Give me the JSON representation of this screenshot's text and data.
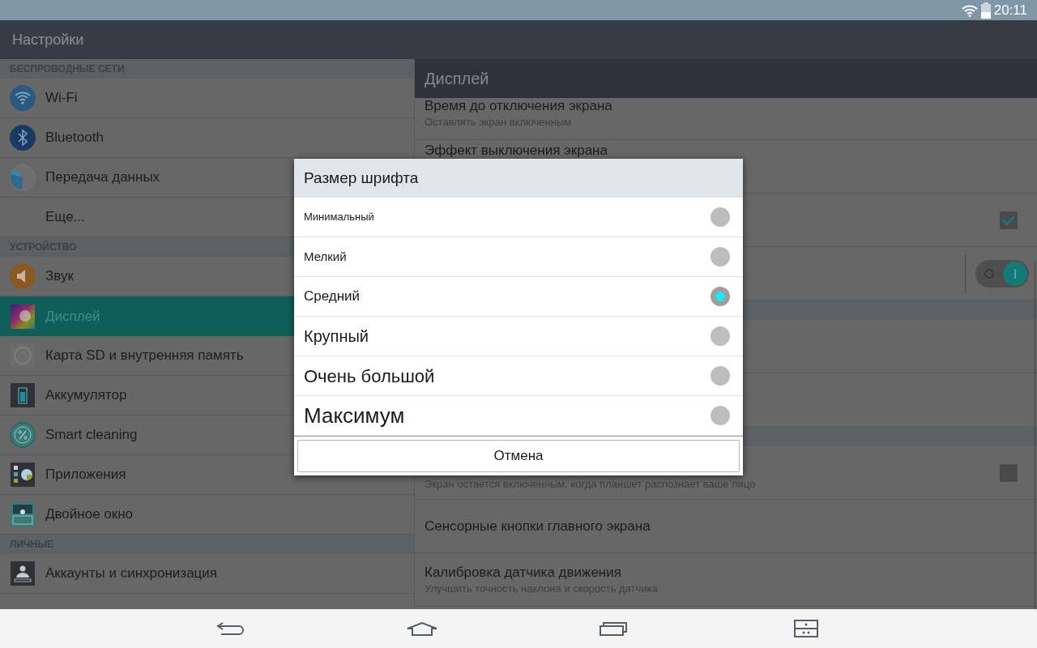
{
  "status_bar": {
    "time": "20:11"
  },
  "action_bar": {
    "title": "Настройки"
  },
  "sidebar": {
    "sections": [
      {
        "header": "БЕСПРОВОДНЫЕ СЕТИ",
        "items": [
          {
            "label": "Wi-Fi",
            "selected": false
          },
          {
            "label": "Bluetooth",
            "selected": false
          },
          {
            "label": "Передача данных",
            "selected": false
          },
          {
            "label": "Еще...",
            "selected": false
          }
        ]
      },
      {
        "header": "УСТРОЙСТВО",
        "items": [
          {
            "label": "Звук",
            "selected": false
          },
          {
            "label": "Дисплей",
            "selected": true
          },
          {
            "label": "Карта SD и внутренняя память",
            "selected": false
          },
          {
            "label": "Аккумулятор",
            "selected": false
          },
          {
            "label": "Smart cleaning",
            "selected": false
          },
          {
            "label": "Приложения",
            "selected": false
          },
          {
            "label": "Двойное окно",
            "selected": false
          }
        ]
      },
      {
        "header": "ЛИЧНЫЕ",
        "items": [
          {
            "label": "Аккаунты и синхронизация",
            "selected": false
          }
        ]
      }
    ]
  },
  "detail": {
    "title": "Дисплей",
    "rows": [
      {
        "kind": "text",
        "title": "Время до отключения экрана",
        "subtitle": "Оставлять экран включенным"
      },
      {
        "kind": "text",
        "title": "Эффект выключения экрана"
      },
      {
        "kind": "checkbox",
        "checked": true
      },
      {
        "kind": "toggle",
        "on": true
      },
      {
        "kind": "section"
      },
      {
        "kind": "blank"
      },
      {
        "kind": "blank"
      },
      {
        "kind": "section"
      },
      {
        "kind": "checkbox",
        "checked": false,
        "subtitle": "Экран остается включенным, когда планшет распознает ваше лицо"
      },
      {
        "kind": "text",
        "title": "Сенсорные кнопки главного экрана"
      },
      {
        "kind": "text",
        "title": "Калибровка датчика движения",
        "subtitle": "Улучшить точность наклона и скорость датчика"
      },
      {
        "kind": "blank"
      }
    ]
  },
  "dialog": {
    "title": "Размер шрифта",
    "options": [
      {
        "label": "Минимальный",
        "selected": false
      },
      {
        "label": "Мелкий",
        "selected": false
      },
      {
        "label": "Средний",
        "selected": true
      },
      {
        "label": "Крупный",
        "selected": false
      },
      {
        "label": "Очень большой",
        "selected": false
      },
      {
        "label": "Максимум",
        "selected": false
      }
    ],
    "cancel": "Отмена"
  }
}
